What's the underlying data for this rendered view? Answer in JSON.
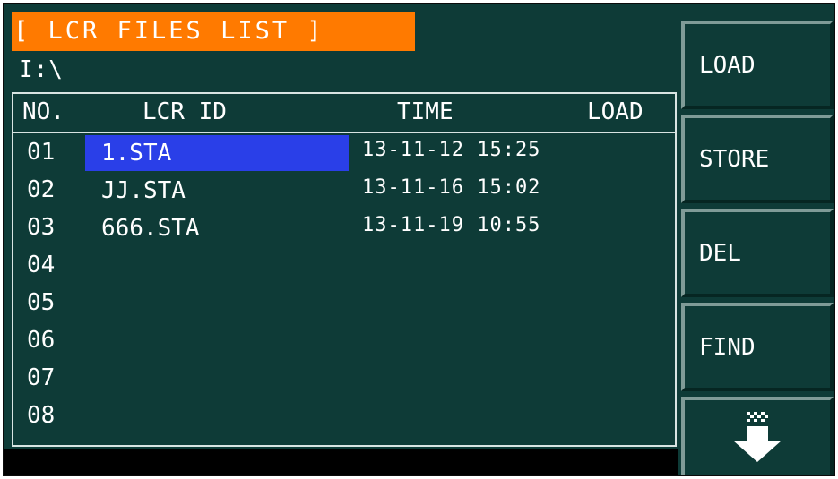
{
  "header": {
    "title": "[ LCR FILES LIST ]",
    "path": "I:\\"
  },
  "table": {
    "columns": {
      "no": "NO.",
      "id": "LCR ID",
      "time": "TIME",
      "load": "LOAD"
    },
    "rows": [
      {
        "no": "01",
        "id": "1.STA",
        "time": "13-11-12 15:25",
        "load": ""
      },
      {
        "no": "02",
        "id": "JJ.STA",
        "time": "13-11-16 15:02",
        "load": ""
      },
      {
        "no": "03",
        "id": "666.STA",
        "time": "13-11-19 10:55",
        "load": ""
      },
      {
        "no": "04",
        "id": "",
        "time": "",
        "load": ""
      },
      {
        "no": "05",
        "id": "",
        "time": "",
        "load": ""
      },
      {
        "no": "06",
        "id": "",
        "time": "",
        "load": ""
      },
      {
        "no": "07",
        "id": "",
        "time": "",
        "load": ""
      },
      {
        "no": "08",
        "id": "",
        "time": "",
        "load": ""
      }
    ],
    "selected_row": 1
  },
  "softkeys": {
    "load": "LOAD",
    "store": "STORE",
    "del": "DEL",
    "find": "FIND",
    "down_icon": "page-down-arrow-icon"
  },
  "colors": {
    "background": "#0e3b37",
    "title_bar": "#ff7a00",
    "selection": "#2a3fe8",
    "text": "#ffffff"
  }
}
